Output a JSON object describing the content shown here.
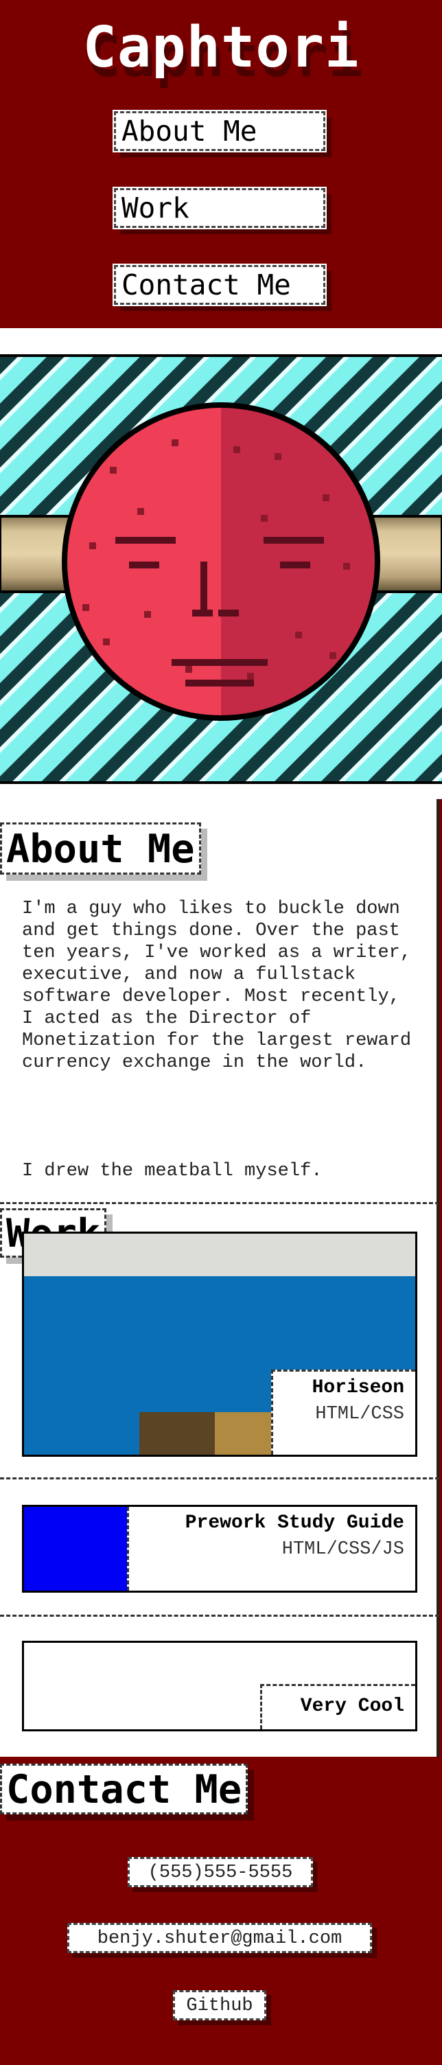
{
  "site": {
    "title": "Caphtori"
  },
  "nav": [
    {
      "label": "About Me"
    },
    {
      "label": "Work"
    },
    {
      "label": "Contact Me"
    }
  ],
  "hero": {
    "image_alt": "pixel-art meatball face"
  },
  "about": {
    "heading": "About Me",
    "paragraph_1": "I'm a guy who likes to buckle down and get things done. Over the past ten years, I've worked as a writer, executive, and now a fullstack software developer. Most recently, I acted as the Director of Monetization for the largest reward currency exchange in the world.",
    "paragraph_2": "I drew the meatball myself."
  },
  "work": {
    "heading": "Work",
    "projects": [
      {
        "title": "Horiseon",
        "tech": "HTML/CSS"
      },
      {
        "title": "Prework Study Guide",
        "tech": "HTML/CSS/JS"
      },
      {
        "title": "Very Cool",
        "tech": ""
      }
    ]
  },
  "contact": {
    "heading": "Contact Me",
    "phone": "(555)555-5555",
    "email": "benjy.shuter@gmail.com",
    "github": "Github"
  },
  "colors": {
    "background": "#7a0000",
    "panel": "#ffffff",
    "meatball": "#e8384f",
    "stripe": "#7ff2ee"
  }
}
